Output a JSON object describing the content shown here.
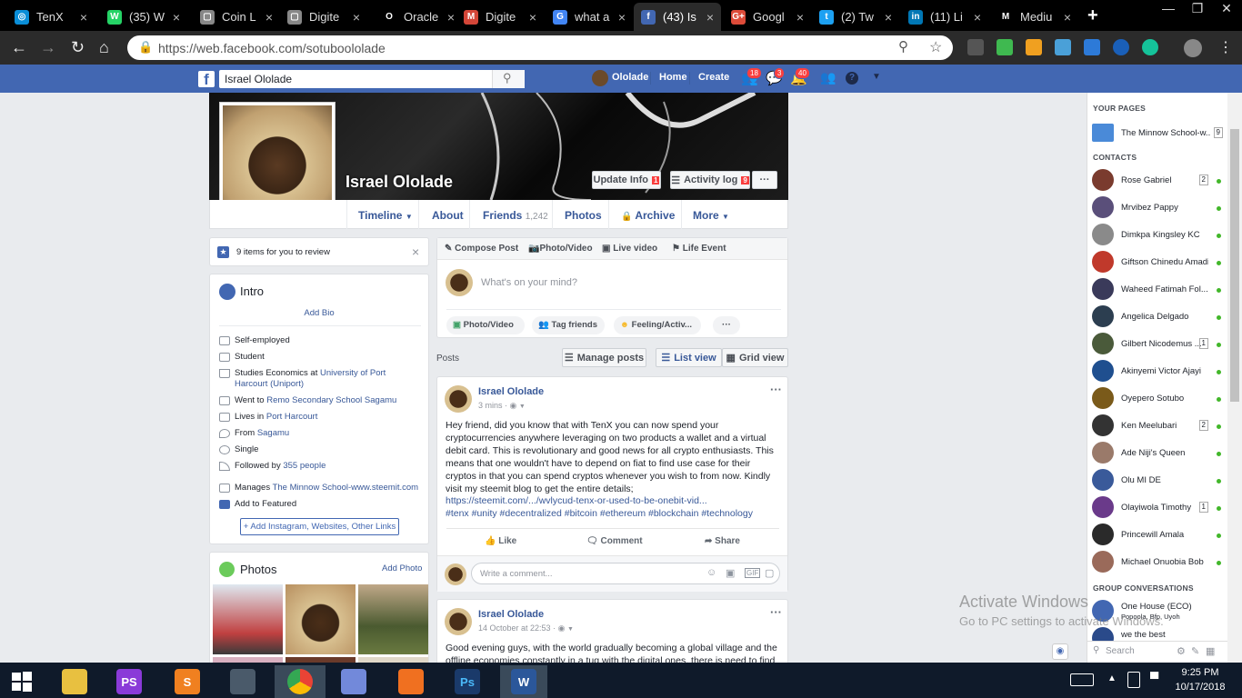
{
  "browser": {
    "tabs": [
      {
        "label": "TenX",
        "icon": "tenx-icon",
        "color": "#0a8ed8"
      },
      {
        "label": "(35) W",
        "icon": "whatsapp-icon",
        "color": "#25d366"
      },
      {
        "label": "Coin L",
        "icon": "page-icon",
        "color": "#888888"
      },
      {
        "label": "Digite",
        "icon": "page-icon",
        "color": "#888888"
      },
      {
        "label": "Oracle",
        "icon": "oracle-icon",
        "color": "#000000"
      },
      {
        "label": "Digite",
        "icon": "gmail-icon",
        "color": "#d44638"
      },
      {
        "label": "what a",
        "icon": "google-icon",
        "color": "#4285f4"
      },
      {
        "label": "(43) Is",
        "icon": "facebook-icon",
        "color": "#4267b2"
      },
      {
        "label": "Googl",
        "icon": "google-plus-icon",
        "color": "#dd4b39"
      },
      {
        "label": "(2) Tw",
        "icon": "twitter-icon",
        "color": "#1da1f2"
      },
      {
        "label": "(11) Li",
        "icon": "linkedin-icon",
        "color": "#0077b5"
      },
      {
        "label": "Mediu",
        "icon": "medium-icon",
        "color": "#000000"
      }
    ],
    "new_tab": "+",
    "url": "https://web.facebook.com/sotuboololade"
  },
  "fb": {
    "logo": "f",
    "search_value": "Israel Ololade",
    "user_name": "Ololade",
    "nav_home": "Home",
    "nav_create": "Create",
    "badge_friends": "18",
    "badge_messages": "3",
    "badge_notifications": "40"
  },
  "profile": {
    "name": "Israel Ololade",
    "update_info": "Update Info",
    "update_info_badge": "1",
    "activity_log": "Activity log",
    "activity_log_badge": "9",
    "more_dots": "···",
    "tabs": {
      "timeline": "Timeline",
      "about": "About",
      "friends": "Friends",
      "friends_count": "1,242",
      "photos": "Photos",
      "archive": "Archive",
      "more": "More"
    }
  },
  "review": {
    "text": "9 items for you to review",
    "close": "×"
  },
  "intro": {
    "title": "Intro",
    "add_bio": "Add Bio",
    "self_employed": "Self-employed",
    "student": "Student",
    "studies_prefix": "Studies Economics at ",
    "studies_school": "University of Port Harcourt (Uniport)",
    "went_prefix": "Went to ",
    "went_school": "Remo Secondary School Sagamu",
    "lives_prefix": "Lives in ",
    "lives_city": "Port Harcourt",
    "from_prefix": "From ",
    "from_city": "Sagamu",
    "relationship": "Single",
    "followed_prefix": "Followed by ",
    "followed_count": "355 people",
    "manages_prefix": "Manages ",
    "manages_page": "The Minnow School-www.steemit.com",
    "add_featured": "Add to Featured",
    "add_links": "+ Add Instagram, Websites, Other Links"
  },
  "photos": {
    "title": "Photos",
    "add_photo": "Add Photo"
  },
  "composer": {
    "compose_post": "Compose Post",
    "photo_video": "Photo/Video",
    "live_video": "Live video",
    "life_event": "Life Event",
    "placeholder": "What's on your mind?",
    "chip_photo": "Photo/Video",
    "chip_tag": "Tag friends",
    "chip_feeling": "Feeling/Activ...",
    "chip_more": "···"
  },
  "posts_header": {
    "label": "Posts",
    "manage": "Manage posts",
    "list_view": "List view",
    "grid_view": "Grid view"
  },
  "post1": {
    "author": "Israel Ololade",
    "time": "3 mins",
    "text": "Hey friend, did you know that with TenX you can now spend your cryptocurrencies anywhere leveraging on two products a wallet and a virtual debit card. This is revolutionary and good news for all crypto enthusiasts. This means that one wouldn't have to depend on fiat to find use case for their cryptos in that you can spend cryptos whenever you wish to from now. Kindly visit my steemit blog to get the entire details;",
    "link": "https://steemit.com/.../wvlycud-tenx-or-used-to-be-onebit-vid...",
    "hashtags": "#tenx #unity #decentralized #bitcoin #ethereum #blockchain #technology",
    "like": "Like",
    "comment": "Comment",
    "share": "Share",
    "comment_placeholder": "Write a comment..."
  },
  "post2": {
    "author": "Israel Ololade",
    "time": "14 October at 22:53",
    "text": "Good evening guys, with the world gradually becoming a global village and the offline economies constantly in a tug with the digital ones, there is need to find"
  },
  "sidebar": {
    "your_pages": "YOUR PAGES",
    "page_name": "The Minnow School-w...",
    "page_count": "9",
    "contacts_label": "CONTACTS",
    "contacts": [
      {
        "name": "Rose Gabriel",
        "count": "2",
        "color": "#7a3b2e"
      },
      {
        "name": "Mrvibez Pappy",
        "count": "",
        "color": "#5a4f7a"
      },
      {
        "name": "Dimkpa Kingsley KC",
        "count": "",
        "color": "#8a8a8a"
      },
      {
        "name": "Giftson Chinedu Amadi",
        "count": "",
        "color": "#c0392b"
      },
      {
        "name": "Waheed Fatimah Fol...",
        "count": "",
        "color": "#3a3a5a"
      },
      {
        "name": "Angelica Delgado",
        "count": "",
        "color": "#2c3e50"
      },
      {
        "name": "Gilbert Nicodemus ...",
        "count": "1",
        "color": "#4a5a3a"
      },
      {
        "name": "Akinyemi Victor Ajayi",
        "count": "",
        "color": "#1f4f8f"
      },
      {
        "name": "Oyepero Sotubo",
        "count": "",
        "color": "#7a5a1a"
      },
      {
        "name": "Ken Meelubari",
        "count": "2",
        "color": "#333333"
      },
      {
        "name": "Ade Niji's Queen",
        "count": "",
        "color": "#9a7a6a"
      },
      {
        "name": "Olu MI DE",
        "count": "",
        "color": "#3a5a9a"
      },
      {
        "name": "Olayiwola Timothy",
        "count": "1",
        "color": "#6a3a8a"
      },
      {
        "name": "Princewill Amala",
        "count": "",
        "color": "#2a2a2a"
      },
      {
        "name": "Michael Onuobia Bob",
        "count": "",
        "color": "#9a6a5a"
      }
    ],
    "group_label": "GROUP CONVERSATIONS",
    "group1_name": "One House (ECO)",
    "group1_sub": "Popoola, Bfp, Uyoh",
    "group2_name": "we the best",
    "search_placeholder": "Search"
  },
  "watermark": {
    "line1": "Activate Windows",
    "line2": "Go to PC settings to activate Windows."
  },
  "taskbar": {
    "time": "9:25 PM",
    "date": "10/17/2018"
  }
}
